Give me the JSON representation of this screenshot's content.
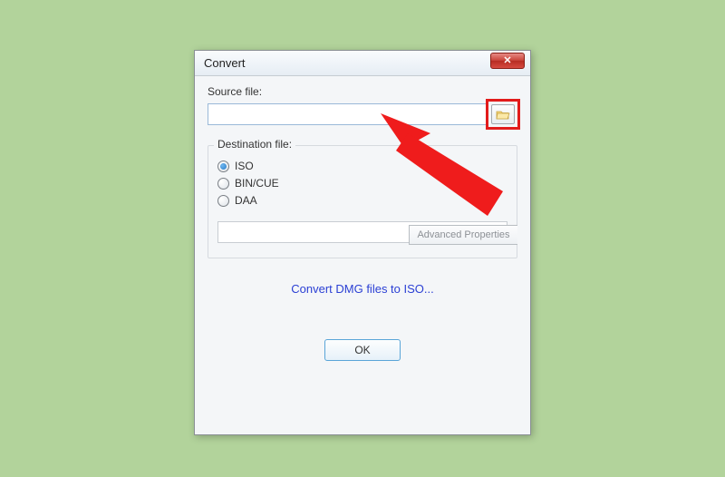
{
  "dialog": {
    "title": "Convert",
    "source_label": "Source file:",
    "source_value": "",
    "destination_label": "Destination file:",
    "destination_value": "",
    "options": {
      "iso": "ISO",
      "bincue": "BIN/CUE",
      "daa": "DAA",
      "selected": "iso"
    },
    "advanced_label": "Advanced Properties",
    "link_text": "Convert DMG files to ISO...",
    "ok_label": "OK"
  },
  "icons": {
    "close": "✕",
    "folder": "folder-open-icon"
  },
  "colors": {
    "highlight": "#e21b1b",
    "link": "#2a3fd4"
  }
}
